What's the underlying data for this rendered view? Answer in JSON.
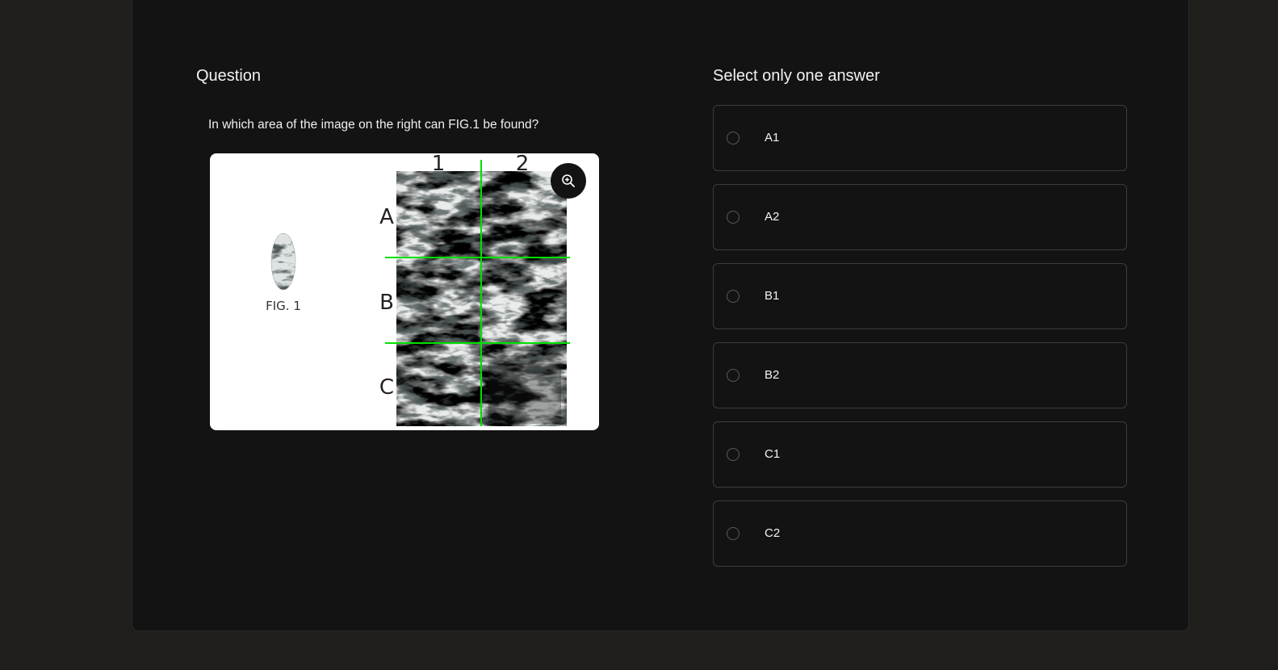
{
  "question": {
    "heading": "Question",
    "text": "In which area of the image on the right can FIG.1 be found?",
    "figure": {
      "fig_label": "FIG. 1",
      "column_labels": [
        "1",
        "2"
      ],
      "row_labels": [
        "A",
        "B",
        "C"
      ],
      "grid_color": "#00e000",
      "zoom_icon": "zoom-in-icon"
    }
  },
  "answers": {
    "heading": "Select only one answer",
    "options": [
      {
        "label": "A1"
      },
      {
        "label": "A2"
      },
      {
        "label": "B1"
      },
      {
        "label": "B2"
      },
      {
        "label": "C1"
      },
      {
        "label": "C2"
      }
    ]
  }
}
